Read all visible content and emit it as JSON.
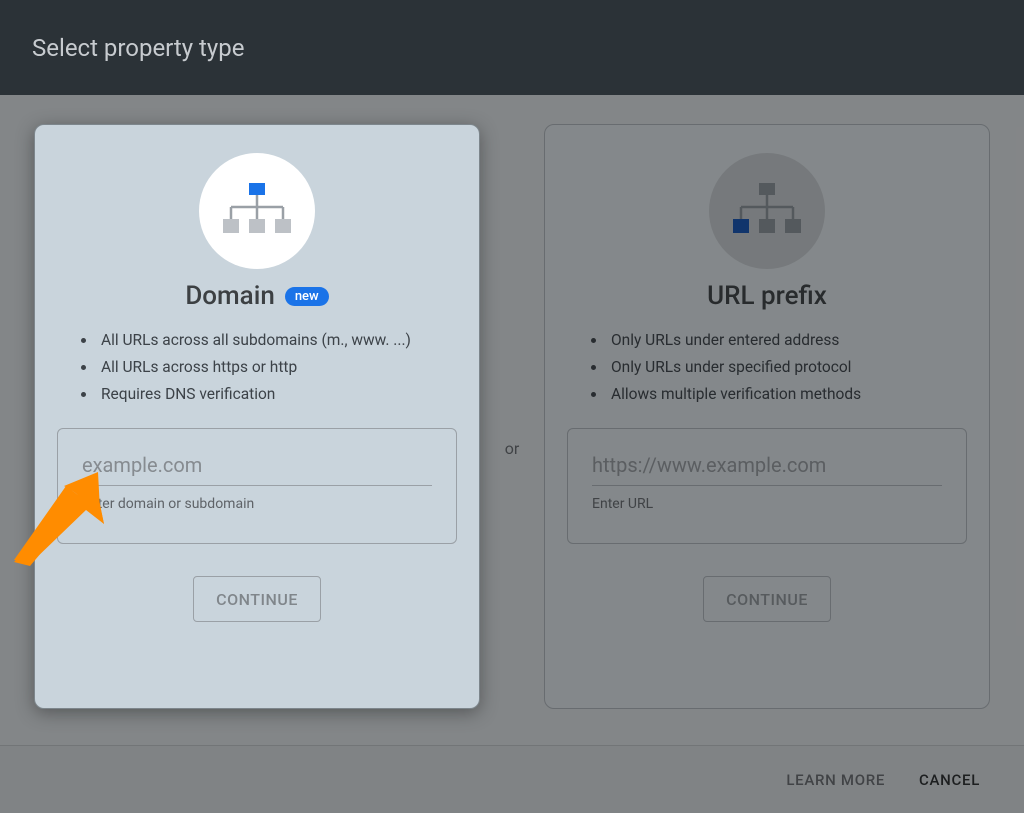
{
  "header": {
    "title": "Select property type"
  },
  "separator": "or",
  "cards": {
    "domain": {
      "title": "Domain",
      "badge": "new",
      "features": [
        "All URLs across all subdomains (m., www. ...)",
        "All URLs across https or http",
        "Requires DNS verification"
      ],
      "input_placeholder": "example.com",
      "input_helper": "Enter domain or subdomain",
      "button": "CONTINUE"
    },
    "url_prefix": {
      "title": "URL prefix",
      "features": [
        "Only URLs under entered address",
        "Only URLs under specified protocol",
        "Allows multiple verification methods"
      ],
      "input_placeholder": "https://www.example.com",
      "input_helper": "Enter URL",
      "button": "CONTINUE"
    }
  },
  "footer": {
    "learn_more": "LEARN MORE",
    "cancel": "CANCEL"
  }
}
